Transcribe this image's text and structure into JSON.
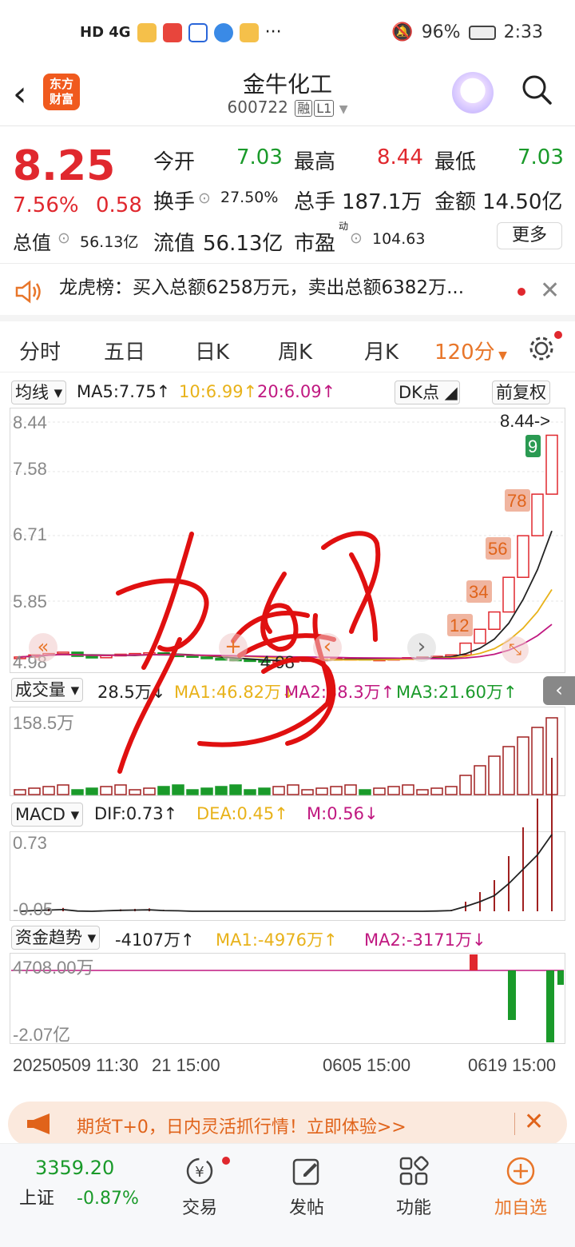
{
  "status": {
    "network": "HD 4G",
    "battery": "96%",
    "time": "2:33"
  },
  "header": {
    "title": "金牛化工",
    "code": "600722",
    "tag1": "融",
    "tag2": "L1",
    "logo": "东方\n财富"
  },
  "quote": {
    "price": "8.25",
    "pct": "7.56%",
    "chg": "0.58",
    "open_label": "今开",
    "open": "7.03",
    "high_label": "最高",
    "high": "8.44",
    "low_label": "最低",
    "low": "7.03",
    "turnover_label": "换手",
    "turnover": "27.50%",
    "vol_label": "总手",
    "vol": "187.1万",
    "amount_label": "金额",
    "amount": "14.50亿",
    "mcap_label": "总值",
    "mcap": "56.13亿",
    "float_label": "流值",
    "float": "56.13亿",
    "pe_label": "市盈",
    "pe_sup": "动",
    "pe": "104.63",
    "more": "更多"
  },
  "notice": {
    "text": "龙虎榜：买入总额6258万元，卖出总额6382万..."
  },
  "tabs": [
    "分时",
    "五日",
    "日K",
    "周K",
    "月K",
    "120分"
  ],
  "kline": {
    "ind": "均线",
    "ma5": "MA5:7.75↑",
    "ma10": "10:6.99↑",
    "ma20": "20:6.09↑",
    "dk": "DK点",
    "adj": "前复权",
    "yticks": [
      "8.44",
      "7.58",
      "6.71",
      "5.85",
      "4.98"
    ],
    "high_label": "8.44->",
    "low_label": "4.98",
    "nine": [
      "9",
      "78",
      "56",
      "34",
      "12"
    ],
    "closes": [
      5.05,
      5.08,
      5.1,
      5.12,
      5.06,
      5.04,
      5.07,
      5.09,
      5.1,
      5.11,
      5.08,
      5.07,
      5.05,
      5.03,
      5.02,
      5.01,
      5.0,
      4.98,
      4.99,
      5.0,
      5.01,
      5.02,
      5.03,
      5.03,
      5.02,
      5.02,
      5.03,
      5.04,
      5.05,
      5.06,
      5.08,
      5.25,
      5.45,
      5.7,
      6.2,
      6.8,
      7.4,
      8.25
    ]
  },
  "volume": {
    "ind": "成交量",
    "v": "28.5万↓",
    "ma1": "MA1:46.82万↓",
    "ma2": "MA2:38.3万↑",
    "ma3": "MA3:21.60万↑",
    "ytick": "158.5万"
  },
  "macd": {
    "ind": "MACD",
    "dif": "DIF:0.73↑",
    "dea": "DEA:0.45↑",
    "m": "M:0.56↓",
    "ytop": "0.73",
    "ybot": "-0.05"
  },
  "fund": {
    "ind": "资金趋势",
    "v": "-4107万↑",
    "ma1": "MA1:-4976万↑",
    "ma2": "MA2:-3171万↓",
    "ytop": "4708.00万",
    "ybot": "-2.07亿"
  },
  "xaxis": [
    "20250509 11:30",
    "21 15:00",
    "0605 15:00",
    "0619 15:00"
  ],
  "ad": {
    "text": "期货T+0，日内灵活抓行情！立即体验>>"
  },
  "bottom": {
    "index": "3359.20",
    "index_name": "上证",
    "index_pct": "-0.87%",
    "trade": "交易",
    "post": "发帖",
    "func": "功能",
    "add": "加自选"
  },
  "colors": {
    "up": "#e0282e",
    "down": "#1a9a2a",
    "accent": "#e8762a"
  }
}
